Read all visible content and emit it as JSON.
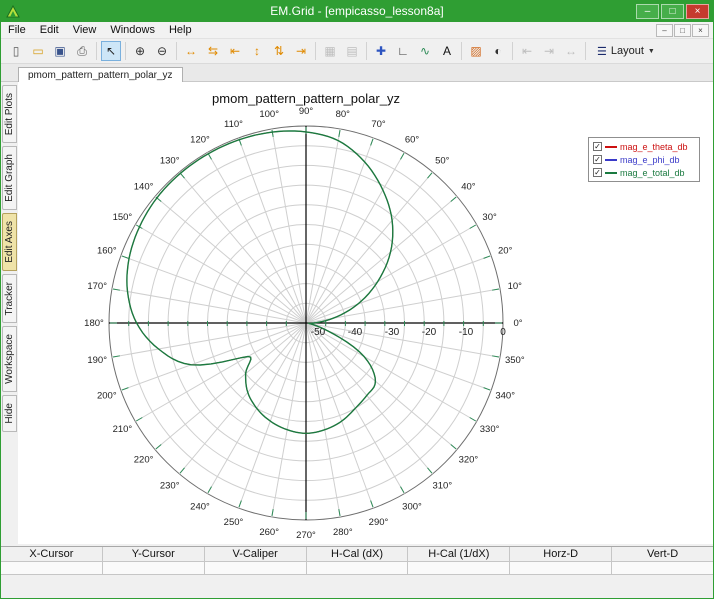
{
  "window": {
    "title": "EM.Grid - [empicasso_lesson8a]",
    "buttons": [
      {
        "name": "minimize-button",
        "glyph": "–"
      },
      {
        "name": "maximize-button",
        "glyph": "□"
      },
      {
        "name": "close-button",
        "glyph": "×"
      }
    ]
  },
  "colors": {
    "titlebar": "#2f9e33",
    "window_border": "#2f9e33",
    "close_button": "#c53a2e",
    "tick_green": "#2e8b57",
    "grid_gray": "#cfcfcf",
    "outer_ring": "#6e6e6e"
  },
  "menu": {
    "items": [
      "File",
      "Edit",
      "View",
      "Windows",
      "Help"
    ],
    "child_window_buttons": [
      {
        "name": "child-minimize-button",
        "glyph": "–"
      },
      {
        "name": "child-restore-button",
        "glyph": "□"
      },
      {
        "name": "child-close-button",
        "glyph": "×"
      }
    ]
  },
  "toolbar": {
    "items": [
      {
        "name": "new-file-button",
        "glyph": "▯",
        "color": "#5a5a5a"
      },
      {
        "name": "open-file-button",
        "glyph": "▭",
        "color": "#d8a020"
      },
      {
        "name": "save-button",
        "glyph": "▣",
        "color": "#39538c"
      },
      {
        "name": "print-button",
        "glyph": "⎙",
        "color": "#555555"
      },
      {
        "type": "separator"
      },
      {
        "name": "select-cursor-button",
        "glyph": "↖",
        "color": "#222222",
        "selected": true
      },
      {
        "type": "separator"
      },
      {
        "name": "zoom-in-button",
        "glyph": "⊕",
        "color": "#333333"
      },
      {
        "name": "zoom-out-button",
        "glyph": "⊖",
        "color": "#333333"
      },
      {
        "type": "separator"
      },
      {
        "name": "autoscale-x-button",
        "glyph": "↔",
        "color": "#e08a00"
      },
      {
        "name": "expand-x-button",
        "glyph": "⇆",
        "color": "#e08a00"
      },
      {
        "name": "shrink-x-button",
        "glyph": "⇤",
        "color": "#e08a00"
      },
      {
        "name": "autoscale-y-button",
        "glyph": "↕",
        "color": "#e08a00"
      },
      {
        "name": "expand-y-button",
        "glyph": "⇅",
        "color": "#e08a00"
      },
      {
        "name": "shrink-y-button",
        "glyph": "⇥",
        "color": "#e08a00"
      },
      {
        "type": "separator"
      },
      {
        "name": "grid-toggle-button",
        "glyph": "▦",
        "color": "#9a9a9a",
        "enabled": false
      },
      {
        "name": "minor-grid-toggle-button",
        "glyph": "▤",
        "color": "#9a9a9a",
        "enabled": false
      },
      {
        "type": "separator"
      },
      {
        "name": "add-marker-button",
        "glyph": "✚",
        "color": "#2d54c0"
      },
      {
        "name": "edit-axes-button",
        "glyph": "∟",
        "color": "#333333"
      },
      {
        "name": "edit-curve-button",
        "glyph": "∿",
        "color": "#2e8b57"
      },
      {
        "name": "add-text-button",
        "glyph": "A",
        "color": "#111111"
      },
      {
        "type": "separator"
      },
      {
        "name": "color-map-button",
        "glyph": "▨",
        "color": "#d2691e"
      },
      {
        "name": "contrast-button",
        "glyph": "◐",
        "color": "#333333"
      },
      {
        "type": "separator"
      },
      {
        "name": "caliper-left-button",
        "glyph": "⇤",
        "color": "#bdbdbd",
        "enabled": false
      },
      {
        "name": "caliper-right-button",
        "glyph": "⇥",
        "color": "#bdbdbd",
        "enabled": false
      },
      {
        "name": "caliper-span-button",
        "glyph": "↔",
        "color": "#bdbdbd",
        "enabled": false
      },
      {
        "type": "separator"
      },
      {
        "name": "layout-menu-button",
        "glyph": "☰",
        "color": "#1a2a6c",
        "label": "Layout",
        "caret": "▼"
      }
    ]
  },
  "tabs": [
    {
      "label": "pmom_pattern_pattern_polar_yz",
      "selected": true
    }
  ],
  "sidebar": {
    "items": [
      {
        "label": "Edit Plots",
        "selected": false
      },
      {
        "label": "Edit Graph",
        "selected": false
      },
      {
        "label": "Edit Axes",
        "selected": true
      },
      {
        "label": "Tracker",
        "selected": false
      },
      {
        "label": "Workspace",
        "selected": false
      },
      {
        "label": "Hide",
        "selected": false
      }
    ]
  },
  "statusbar": {
    "columns": [
      "X-Cursor",
      "Y-Cursor",
      "V-Caliper",
      "H-Cal (dX)",
      "H-Cal (1/dX)",
      "Horz-D",
      "Vert-D"
    ],
    "values": [
      "",
      "",
      "",
      "",
      "",
      "",
      ""
    ]
  },
  "chart_data": {
    "type": "polar_line",
    "title": "pmom_pattern_pattern_polar_yz",
    "r_range": [
      -50,
      0
    ],
    "r_tick_labels": [
      "-50",
      "-40",
      "-30",
      "-20",
      "-10",
      "0"
    ],
    "angle_step_deg": 10,
    "angle_labels": [
      "0°",
      "10°",
      "20°",
      "30°",
      "40°",
      "50°",
      "60°",
      "70°",
      "80°",
      "90°",
      "100°",
      "110°",
      "120°",
      "130°",
      "140°",
      "150°",
      "160°",
      "170°",
      "180°",
      "190°",
      "200°",
      "210°",
      "220°",
      "230°",
      "240°",
      "250°",
      "260°",
      "270°",
      "280°",
      "290°",
      "300°",
      "310°",
      "320°",
      "330°",
      "340°",
      "350°"
    ],
    "legend_position": "top-right",
    "grid": true,
    "series": [
      {
        "name": "mag_e_theta_db",
        "color": "#cc1111",
        "checked": true,
        "values": [
          -48,
          -43,
          -36,
          -29,
          -22,
          -16,
          -11,
          -6.5,
          -3,
          -1.5,
          -0.8,
          -0.5,
          -0.4,
          -0.4,
          -0.6,
          -1.2,
          -2.2,
          -4,
          -7,
          -12,
          -19,
          -33,
          -30,
          -27,
          -25,
          -23.5,
          -22.5,
          -22,
          -22.5,
          -23.5,
          -25,
          -26,
          -27,
          -33,
          -44,
          -49
        ]
      },
      {
        "name": "mag_e_phi_db",
        "color": "#3a3ac8",
        "checked": true,
        "values": [
          -50,
          -50,
          -50,
          -50,
          -50,
          -50,
          -50,
          -50,
          -50,
          -50,
          -50,
          -50,
          -50,
          -50,
          -50,
          -50,
          -50,
          -50,
          -50,
          -50,
          -50,
          -50,
          -50,
          -50,
          -50,
          -50,
          -50,
          -50,
          -50,
          -50,
          -50,
          -50,
          -50,
          -50,
          -50,
          -50
        ]
      },
      {
        "name": "mag_e_total_db",
        "color": "#1a7a40",
        "checked": true,
        "values": [
          -48,
          -43,
          -36,
          -29,
          -22,
          -16,
          -11,
          -6.5,
          -3,
          -1.5,
          -0.8,
          -0.5,
          -0.4,
          -0.4,
          -0.6,
          -1.2,
          -2.2,
          -4,
          -7,
          -12,
          -19,
          -33,
          -30,
          -27,
          -25,
          -23.5,
          -22.5,
          -22,
          -22.5,
          -23.5,
          -25,
          -26,
          -27,
          -33,
          -44,
          -49
        ]
      }
    ]
  }
}
